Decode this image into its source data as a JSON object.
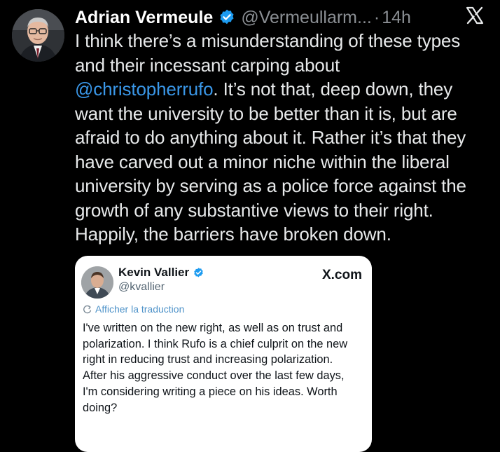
{
  "post": {
    "author_name": "Adrian Vermeule",
    "handle": "@Vermeullarm...",
    "dot": "·",
    "time": "14h",
    "text_lines": [
      [
        "I think there’s a misunderstanding of these types",
        ""
      ],
      [
        "and their incessant carping about",
        ""
      ],
      [
        "",
        "@christopherrufo"
      ],
      [
        "want the university to be better than it is, but are",
        ""
      ],
      [
        "afraid to do anything about it. Rather it’s that they",
        ""
      ],
      [
        "have carved out a minor niche within the liberal",
        ""
      ],
      [
        "university by serving as a police force against the",
        ""
      ],
      [
        "growth of any substantive views to their right.",
        ""
      ],
      [
        "Happily, the barriers have broken down.",
        ""
      ]
    ],
    "mention_suffix": ". It’s not that, deep down, they"
  },
  "quote": {
    "name": "Kevin Vallier",
    "handle": "@kvallier",
    "site": "X.com",
    "translate_label": "Afficher la traduction",
    "text_lines": [
      "I've written on the new right, as well as on trust and",
      "polarization. I think Rufo is a chief culprit on the new",
      "right in reducing trust and increasing polarization.",
      "After his aggressive conduct over the last few days,",
      "I'm considering writing a piece on his ideas. Worth",
      "doing?"
    ]
  },
  "colors": {
    "background": "#000000",
    "text": "#e7e9ea",
    "muted": "#8b8f94",
    "mention": "#3a97e8",
    "verified": "#1d9bf0"
  },
  "icons": {
    "verified": "verified-badge-icon",
    "logo": "x-logo-icon",
    "translate": "translate-icon"
  }
}
